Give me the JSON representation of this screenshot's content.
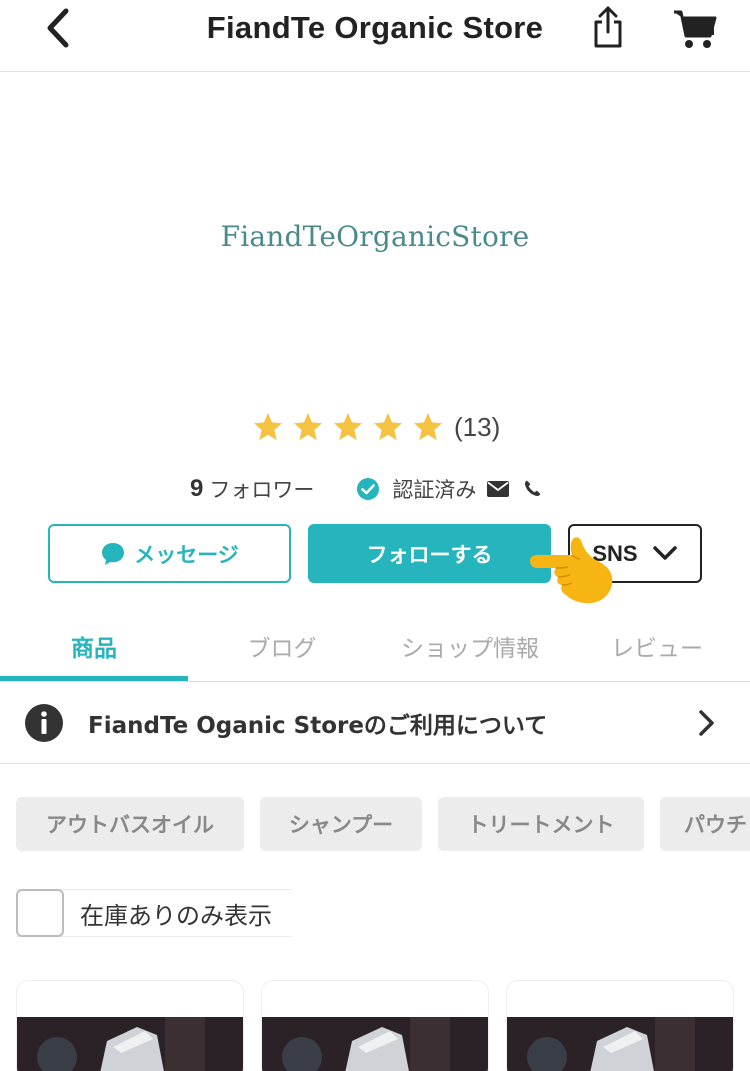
{
  "header": {
    "title": "FiandTe Organic Store",
    "back_icon": "chevron-left-icon",
    "share_icon": "share-icon",
    "cart_icon": "cart-icon"
  },
  "store": {
    "logo_text": "FiandTeOrganicStore",
    "rating": {
      "stars": 5,
      "count_text": "(13)"
    },
    "followers": {
      "count": "9",
      "label": "フォロワー"
    },
    "verified_label": "認証済み",
    "contact_icons": [
      "mail-icon",
      "phone-icon"
    ]
  },
  "actions": {
    "message_label": "メッセージ",
    "follow_label": "フォローする",
    "sns_label": "SNS"
  },
  "tabs": [
    {
      "label": "商品",
      "active": true
    },
    {
      "label": "ブログ",
      "active": false
    },
    {
      "label": "ショップ情報",
      "active": false
    },
    {
      "label": "レビュー",
      "active": false
    }
  ],
  "notice": {
    "text": "FiandTe Oganic Storeのご利用について"
  },
  "categories": [
    "アウトバスオイル",
    "シャンプー",
    "トリートメント",
    "パウチ"
  ],
  "filter": {
    "in_stock_label": "在庫ありのみ表示",
    "checked": false
  },
  "colors": {
    "accent": "#26b5bd",
    "star": "#f5c242",
    "logo": "#4a8a8a"
  }
}
